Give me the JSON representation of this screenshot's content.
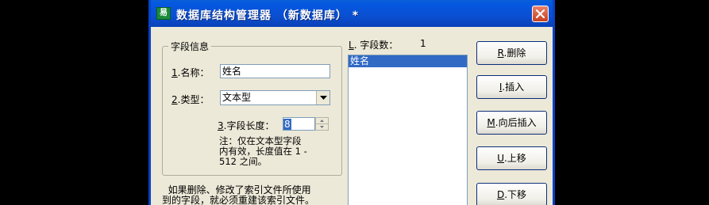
{
  "window": {
    "title": "数据库结构管理器  （新数据库）  *"
  },
  "field_info": {
    "group_title": "字段信息",
    "name_accel": "1",
    "name_label": ".名称：",
    "name_value": "姓名",
    "type_accel": "2",
    "type_label": ".类型：",
    "type_value": "文本型",
    "length_accel": "3",
    "length_label": ".字段长度：",
    "length_value": "8",
    "note": "注：仅在文本型字段\n内有效，长度值在 1 -\n512 之间。"
  },
  "field_list": {
    "count_accel": "L",
    "count_label": ". 字段数：",
    "count_value": "1",
    "items": [
      "姓名"
    ]
  },
  "buttons": {
    "delete": {
      "accel": "R",
      "label": ".删除"
    },
    "insert": {
      "accel": "I",
      "label": ".插入"
    },
    "insert_after": {
      "accel": "M",
      "label": ".向后插入"
    },
    "move_up": {
      "accel": "U",
      "label": ".上移"
    },
    "move_down": {
      "accel": "D",
      "label": ".下移"
    }
  },
  "bottom_note": "  如果删除、修改了索引文件所使用\n到的字段，就必须重建该索引文件。"
}
